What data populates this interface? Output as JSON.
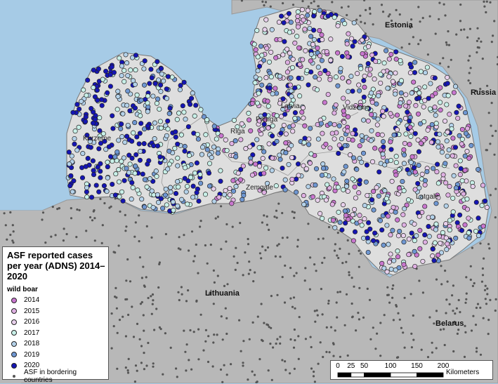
{
  "map": {
    "countries": [
      {
        "key": "estonia",
        "label": "Estonia"
      },
      {
        "key": "russia",
        "label": "Russia"
      },
      {
        "key": "lithuania",
        "label": "Lithuania"
      },
      {
        "key": "belarus",
        "label": "Belarus"
      }
    ],
    "regions": [
      {
        "key": "kurzeme",
        "label": "Kurzeme"
      },
      {
        "key": "riga",
        "label": "Riga"
      },
      {
        "key": "pieriga",
        "label": "Pieriga"
      },
      {
        "key": "vidzeme",
        "label": "Vidzeme"
      },
      {
        "key": "zemgale",
        "label": "Zemgale"
      },
      {
        "key": "latgale",
        "label": "Latgale"
      },
      {
        "key": "latvia",
        "label": "Latvia"
      }
    ],
    "colors": {
      "sea": "#a6cbe6",
      "latvia_land": "#dedede",
      "neighbour_land": "#b8b8b8",
      "border": "#888888",
      "bordering_cases": "#555555"
    }
  },
  "legend": {
    "title": "ASF reported cases per year (ADNS) 2014–2020",
    "subtitle": "wild boar",
    "items": [
      {
        "label": "2014",
        "color": "#c977cf"
      },
      {
        "label": "2015",
        "color": "#dfb0e3"
      },
      {
        "label": "2016",
        "color": "#e8d0ec"
      },
      {
        "label": "2017",
        "color": "#c8f0e8"
      },
      {
        "label": "2018",
        "color": "#b4d2ea"
      },
      {
        "label": "2019",
        "color": "#6f97d2"
      },
      {
        "label": "2020",
        "color": "#1515b4"
      }
    ],
    "bordering_label": "ASF in bordering countries"
  },
  "scalebar": {
    "ticks": [
      "0",
      "25",
      "50",
      "100",
      "150",
      "200"
    ],
    "unit": "Kilometers"
  }
}
